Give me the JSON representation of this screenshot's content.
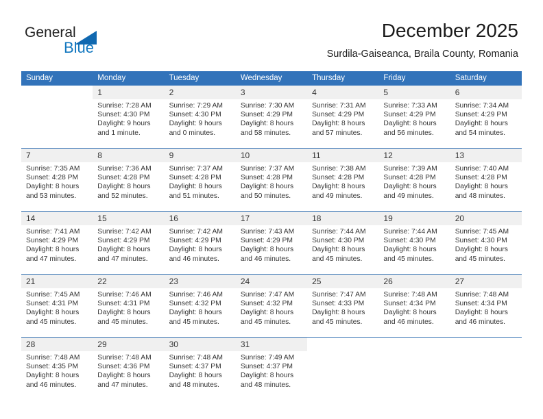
{
  "brand": {
    "name_part1": "General",
    "name_part2": "Blue",
    "triangle_icon": "triangle-icon",
    "accent_color": "#1277bf"
  },
  "header": {
    "title": "December 2025",
    "subtitle": "Surdila-Gaiseanca, Braila County, Romania"
  },
  "calendar": {
    "header_bg": "#3273ba",
    "daynum_bg": "#f0f0f0",
    "separator_color": "#2a6bb0",
    "weekday_headers": [
      "Sunday",
      "Monday",
      "Tuesday",
      "Wednesday",
      "Thursday",
      "Friday",
      "Saturday"
    ],
    "weeks": [
      [
        {
          "day": "",
          "sunrise": "",
          "sunset": "",
          "daylight1": "",
          "daylight2": ""
        },
        {
          "day": "1",
          "sunrise": "Sunrise: 7:28 AM",
          "sunset": "Sunset: 4:30 PM",
          "daylight1": "Daylight: 9 hours",
          "daylight2": "and 1 minute."
        },
        {
          "day": "2",
          "sunrise": "Sunrise: 7:29 AM",
          "sunset": "Sunset: 4:30 PM",
          "daylight1": "Daylight: 9 hours",
          "daylight2": "and 0 minutes."
        },
        {
          "day": "3",
          "sunrise": "Sunrise: 7:30 AM",
          "sunset": "Sunset: 4:29 PM",
          "daylight1": "Daylight: 8 hours",
          "daylight2": "and 58 minutes."
        },
        {
          "day": "4",
          "sunrise": "Sunrise: 7:31 AM",
          "sunset": "Sunset: 4:29 PM",
          "daylight1": "Daylight: 8 hours",
          "daylight2": "and 57 minutes."
        },
        {
          "day": "5",
          "sunrise": "Sunrise: 7:33 AM",
          "sunset": "Sunset: 4:29 PM",
          "daylight1": "Daylight: 8 hours",
          "daylight2": "and 56 minutes."
        },
        {
          "day": "6",
          "sunrise": "Sunrise: 7:34 AM",
          "sunset": "Sunset: 4:29 PM",
          "daylight1": "Daylight: 8 hours",
          "daylight2": "and 54 minutes."
        }
      ],
      [
        {
          "day": "7",
          "sunrise": "Sunrise: 7:35 AM",
          "sunset": "Sunset: 4:28 PM",
          "daylight1": "Daylight: 8 hours",
          "daylight2": "and 53 minutes."
        },
        {
          "day": "8",
          "sunrise": "Sunrise: 7:36 AM",
          "sunset": "Sunset: 4:28 PM",
          "daylight1": "Daylight: 8 hours",
          "daylight2": "and 52 minutes."
        },
        {
          "day": "9",
          "sunrise": "Sunrise: 7:37 AM",
          "sunset": "Sunset: 4:28 PM",
          "daylight1": "Daylight: 8 hours",
          "daylight2": "and 51 minutes."
        },
        {
          "day": "10",
          "sunrise": "Sunrise: 7:37 AM",
          "sunset": "Sunset: 4:28 PM",
          "daylight1": "Daylight: 8 hours",
          "daylight2": "and 50 minutes."
        },
        {
          "day": "11",
          "sunrise": "Sunrise: 7:38 AM",
          "sunset": "Sunset: 4:28 PM",
          "daylight1": "Daylight: 8 hours",
          "daylight2": "and 49 minutes."
        },
        {
          "day": "12",
          "sunrise": "Sunrise: 7:39 AM",
          "sunset": "Sunset: 4:28 PM",
          "daylight1": "Daylight: 8 hours",
          "daylight2": "and 49 minutes."
        },
        {
          "day": "13",
          "sunrise": "Sunrise: 7:40 AM",
          "sunset": "Sunset: 4:28 PM",
          "daylight1": "Daylight: 8 hours",
          "daylight2": "and 48 minutes."
        }
      ],
      [
        {
          "day": "14",
          "sunrise": "Sunrise: 7:41 AM",
          "sunset": "Sunset: 4:29 PM",
          "daylight1": "Daylight: 8 hours",
          "daylight2": "and 47 minutes."
        },
        {
          "day": "15",
          "sunrise": "Sunrise: 7:42 AM",
          "sunset": "Sunset: 4:29 PM",
          "daylight1": "Daylight: 8 hours",
          "daylight2": "and 47 minutes."
        },
        {
          "day": "16",
          "sunrise": "Sunrise: 7:42 AM",
          "sunset": "Sunset: 4:29 PM",
          "daylight1": "Daylight: 8 hours",
          "daylight2": "and 46 minutes."
        },
        {
          "day": "17",
          "sunrise": "Sunrise: 7:43 AM",
          "sunset": "Sunset: 4:29 PM",
          "daylight1": "Daylight: 8 hours",
          "daylight2": "and 46 minutes."
        },
        {
          "day": "18",
          "sunrise": "Sunrise: 7:44 AM",
          "sunset": "Sunset: 4:30 PM",
          "daylight1": "Daylight: 8 hours",
          "daylight2": "and 45 minutes."
        },
        {
          "day": "19",
          "sunrise": "Sunrise: 7:44 AM",
          "sunset": "Sunset: 4:30 PM",
          "daylight1": "Daylight: 8 hours",
          "daylight2": "and 45 minutes."
        },
        {
          "day": "20",
          "sunrise": "Sunrise: 7:45 AM",
          "sunset": "Sunset: 4:30 PM",
          "daylight1": "Daylight: 8 hours",
          "daylight2": "and 45 minutes."
        }
      ],
      [
        {
          "day": "21",
          "sunrise": "Sunrise: 7:45 AM",
          "sunset": "Sunset: 4:31 PM",
          "daylight1": "Daylight: 8 hours",
          "daylight2": "and 45 minutes."
        },
        {
          "day": "22",
          "sunrise": "Sunrise: 7:46 AM",
          "sunset": "Sunset: 4:31 PM",
          "daylight1": "Daylight: 8 hours",
          "daylight2": "and 45 minutes."
        },
        {
          "day": "23",
          "sunrise": "Sunrise: 7:46 AM",
          "sunset": "Sunset: 4:32 PM",
          "daylight1": "Daylight: 8 hours",
          "daylight2": "and 45 minutes."
        },
        {
          "day": "24",
          "sunrise": "Sunrise: 7:47 AM",
          "sunset": "Sunset: 4:32 PM",
          "daylight1": "Daylight: 8 hours",
          "daylight2": "and 45 minutes."
        },
        {
          "day": "25",
          "sunrise": "Sunrise: 7:47 AM",
          "sunset": "Sunset: 4:33 PM",
          "daylight1": "Daylight: 8 hours",
          "daylight2": "and 45 minutes."
        },
        {
          "day": "26",
          "sunrise": "Sunrise: 7:48 AM",
          "sunset": "Sunset: 4:34 PM",
          "daylight1": "Daylight: 8 hours",
          "daylight2": "and 46 minutes."
        },
        {
          "day": "27",
          "sunrise": "Sunrise: 7:48 AM",
          "sunset": "Sunset: 4:34 PM",
          "daylight1": "Daylight: 8 hours",
          "daylight2": "and 46 minutes."
        }
      ],
      [
        {
          "day": "28",
          "sunrise": "Sunrise: 7:48 AM",
          "sunset": "Sunset: 4:35 PM",
          "daylight1": "Daylight: 8 hours",
          "daylight2": "and 46 minutes."
        },
        {
          "day": "29",
          "sunrise": "Sunrise: 7:48 AM",
          "sunset": "Sunset: 4:36 PM",
          "daylight1": "Daylight: 8 hours",
          "daylight2": "and 47 minutes."
        },
        {
          "day": "30",
          "sunrise": "Sunrise: 7:48 AM",
          "sunset": "Sunset: 4:37 PM",
          "daylight1": "Daylight: 8 hours",
          "daylight2": "and 48 minutes."
        },
        {
          "day": "31",
          "sunrise": "Sunrise: 7:49 AM",
          "sunset": "Sunset: 4:37 PM",
          "daylight1": "Daylight: 8 hours",
          "daylight2": "and 48 minutes."
        },
        {
          "day": "",
          "sunrise": "",
          "sunset": "",
          "daylight1": "",
          "daylight2": ""
        },
        {
          "day": "",
          "sunrise": "",
          "sunset": "",
          "daylight1": "",
          "daylight2": ""
        },
        {
          "day": "",
          "sunrise": "",
          "sunset": "",
          "daylight1": "",
          "daylight2": ""
        }
      ]
    ]
  }
}
